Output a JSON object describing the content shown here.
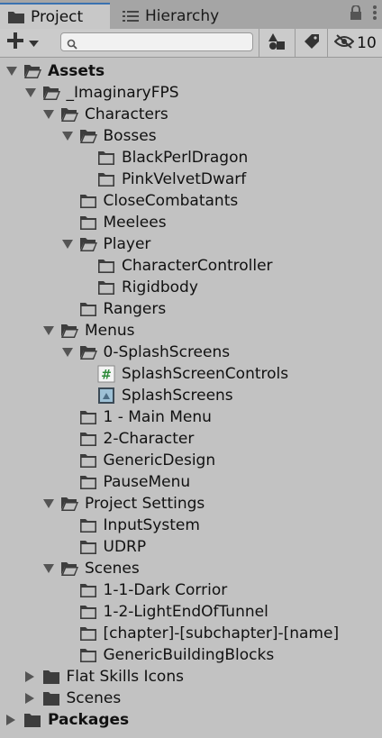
{
  "tabs": [
    {
      "label": "Project",
      "icon": "folder-icon",
      "active": true
    },
    {
      "label": "Hierarchy",
      "icon": "list-icon",
      "active": false
    }
  ],
  "toolbar": {
    "search_placeholder": "",
    "hidden_count": "10"
  },
  "tree": [
    {
      "label": "Assets",
      "depth": 0,
      "expander": "expanded",
      "icon": "folder-open",
      "bold": true
    },
    {
      "label": "_ImaginaryFPS",
      "depth": 1,
      "expander": "expanded",
      "icon": "folder-open"
    },
    {
      "label": "Characters",
      "depth": 2,
      "expander": "expanded",
      "icon": "folder-open"
    },
    {
      "label": "Bosses",
      "depth": 3,
      "expander": "expanded",
      "icon": "folder-open"
    },
    {
      "label": "BlackPerlDragon",
      "depth": 4,
      "expander": "none",
      "icon": "folder"
    },
    {
      "label": "PinkVelvetDwarf",
      "depth": 4,
      "expander": "none",
      "icon": "folder"
    },
    {
      "label": "CloseCombatants",
      "depth": 3,
      "expander": "none",
      "icon": "folder"
    },
    {
      "label": "Meelees",
      "depth": 3,
      "expander": "none",
      "icon": "folder"
    },
    {
      "label": "Player",
      "depth": 3,
      "expander": "expanded",
      "icon": "folder-open"
    },
    {
      "label": "CharacterController",
      "depth": 4,
      "expander": "none",
      "icon": "folder"
    },
    {
      "label": "Rigidbody",
      "depth": 4,
      "expander": "none",
      "icon": "folder"
    },
    {
      "label": "Rangers",
      "depth": 3,
      "expander": "none",
      "icon": "folder"
    },
    {
      "label": "Menus",
      "depth": 2,
      "expander": "expanded",
      "icon": "folder-open"
    },
    {
      "label": "0-SplashScreens",
      "depth": 3,
      "expander": "expanded",
      "icon": "folder-open"
    },
    {
      "label": "SplashScreenControls",
      "depth": 4,
      "expander": "none",
      "icon": "script"
    },
    {
      "label": "SplashScreens",
      "depth": 4,
      "expander": "none",
      "icon": "scene"
    },
    {
      "label": "1 - Main Menu",
      "depth": 3,
      "expander": "none",
      "icon": "folder"
    },
    {
      "label": "2-Character",
      "depth": 3,
      "expander": "none",
      "icon": "folder"
    },
    {
      "label": "GenericDesign",
      "depth": 3,
      "expander": "none",
      "icon": "folder"
    },
    {
      "label": "PauseMenu",
      "depth": 3,
      "expander": "none",
      "icon": "folder"
    },
    {
      "label": "Project Settings",
      "depth": 2,
      "expander": "expanded",
      "icon": "folder-open"
    },
    {
      "label": "InputSystem",
      "depth": 3,
      "expander": "none",
      "icon": "folder"
    },
    {
      "label": "UDRP",
      "depth": 3,
      "expander": "none",
      "icon": "folder"
    },
    {
      "label": "Scenes",
      "depth": 2,
      "expander": "expanded",
      "icon": "folder-open"
    },
    {
      "label": "1-1-Dark Corrior",
      "depth": 3,
      "expander": "none",
      "icon": "folder"
    },
    {
      "label": "1-2-LightEndOfTunnel",
      "depth": 3,
      "expander": "none",
      "icon": "folder"
    },
    {
      "label": "[chapter]-[subchapter]-[name]",
      "depth": 3,
      "expander": "none",
      "icon": "folder"
    },
    {
      "label": "GenericBuildingBlocks",
      "depth": 3,
      "expander": "none",
      "icon": "folder"
    },
    {
      "label": "Flat Skills Icons",
      "depth": 1,
      "expander": "collapsed",
      "icon": "folder-filled"
    },
    {
      "label": "Scenes",
      "depth": 1,
      "expander": "collapsed",
      "icon": "folder-filled"
    },
    {
      "label": "Packages",
      "depth": 0,
      "expander": "collapsed",
      "icon": "folder-filled",
      "bold": true
    }
  ],
  "colors": {
    "background": "#c2c2c2",
    "tab_active_accent": "#3a72b0",
    "folder": "#3d3d3d",
    "script_green": "#2e8b3a"
  }
}
